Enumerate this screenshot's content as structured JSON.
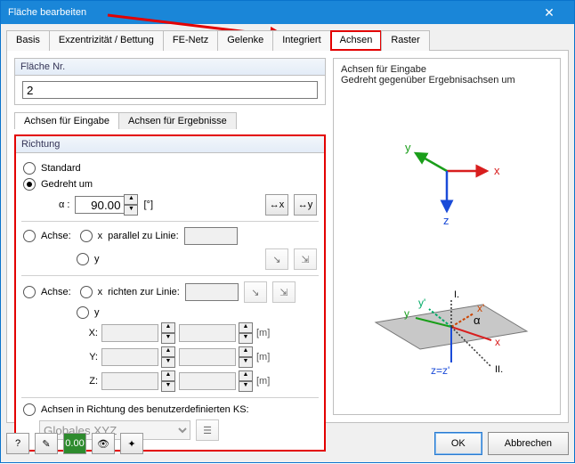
{
  "window": {
    "title": "Fläche bearbeiten",
    "close": "✕"
  },
  "tabs": {
    "items": [
      "Basis",
      "Exzentrizität / Bettung",
      "FE-Netz",
      "Gelenke",
      "Integriert",
      "Achsen",
      "Raster"
    ],
    "active": 5
  },
  "surface_no": {
    "label": "Fläche Nr.",
    "value": "2"
  },
  "subtabs": {
    "items": [
      "Achsen für Eingabe",
      "Achsen für Ergebnisse"
    ],
    "active": 0
  },
  "direction": {
    "title": "Richtung",
    "standard": "Standard",
    "rotated": "Gedreht um",
    "alpha_label": "α :",
    "alpha_value": "90.00",
    "alpha_unit": "[°]",
    "axis_label": "Achse:",
    "x": "x",
    "y": "y",
    "parallel": "parallel zu Linie:",
    "towards": "richten zur Linie:",
    "coord_x": "X:",
    "coord_y": "Y:",
    "coord_z": "Z:",
    "unit_m": "[m]",
    "userks": "Achsen in Richtung des benutzerdefinierten KS:",
    "combo": "Globales XYZ"
  },
  "preview": {
    "heading": "Achsen für Eingabe",
    "sub": "Gedreht gegenüber Ergebnisachsen um",
    "ax_x": "x",
    "ax_y": "y",
    "ax_z": "z",
    "ax_xp": "x'",
    "ax_yp": "y'",
    "ax_zz": "z=z'",
    "alpha": "α",
    "roman1": "I.",
    "roman2": "II."
  },
  "buttons": {
    "ok": "OK",
    "cancel": "Abbrechen"
  }
}
